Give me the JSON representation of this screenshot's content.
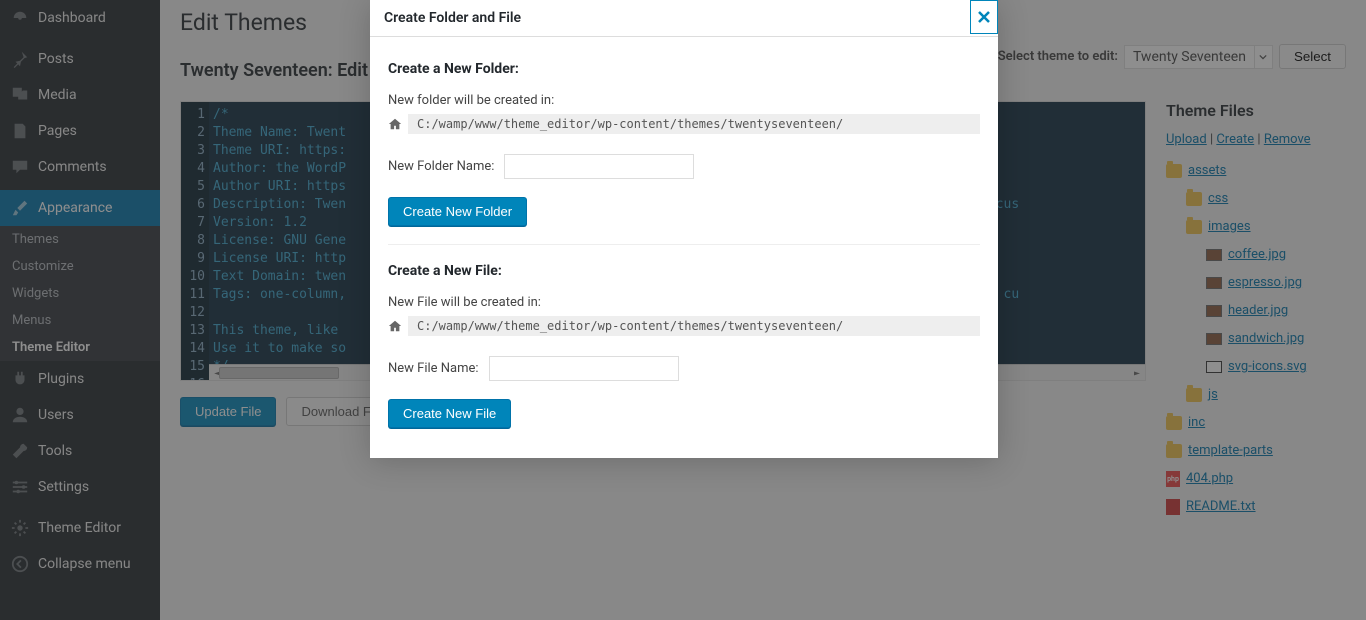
{
  "sidebar": {
    "items": [
      {
        "label": "Dashboard"
      },
      {
        "label": "Posts"
      },
      {
        "label": "Media"
      },
      {
        "label": "Pages"
      },
      {
        "label": "Comments"
      },
      {
        "label": "Appearance",
        "active": true
      },
      {
        "label": "Plugins"
      },
      {
        "label": "Users"
      },
      {
        "label": "Tools"
      },
      {
        "label": "Settings"
      },
      {
        "label": "Theme Editor"
      },
      {
        "label": "Collapse menu"
      }
    ],
    "submenu": [
      {
        "label": "Themes"
      },
      {
        "label": "Customize"
      },
      {
        "label": "Widgets"
      },
      {
        "label": "Menus"
      },
      {
        "label": "Theme Editor",
        "current": true
      }
    ]
  },
  "page": {
    "title": "Edit Themes",
    "subtitle": "Twenty Seventeen: Edit",
    "select_label": "Select theme to edit:",
    "selected_theme": "Twenty Seventeen",
    "select_button": "Select"
  },
  "code": {
    "lines": [
      "/*",
      "Theme Name: Twent",
      "Theme URI: https:",
      "Author: the WordP",
      "Author URI: https",
      "Description: Twen                                                                  images. With a focus",
      "Version: 1.2",
      "License: GNU Gene",
      "License URI: http",
      "Text Domain: twen",
      "Tags: one-column,                                                                  s, custom-header, cu",
      "",
      "This theme, like ",
      "Use it to make so",
      "*/",
      ""
    ]
  },
  "buttons": {
    "update": "Update File",
    "download": "Download File"
  },
  "files": {
    "heading": "Theme Files",
    "actions": {
      "upload": "Upload",
      "create": "Create",
      "remove": "Remove",
      "sep": " | "
    },
    "tree": {
      "assets": "assets",
      "css": "css",
      "images": "images",
      "coffee": "coffee.jpg",
      "espresso": "espresso.jpg",
      "header": "header.jpg",
      "sandwich": "sandwich.jpg",
      "svgicons": "svg-icons.svg",
      "js": "js",
      "inc": "inc",
      "templateparts": "template-parts",
      "f404": "404.php",
      "readme": "README.txt"
    }
  },
  "modal": {
    "title": "Create Folder and File",
    "folder": {
      "heading": "Create a New Folder:",
      "path_label": "New folder will be created in:",
      "path": "C:/wamp/www/theme_editor/wp-content/themes/twentyseventeen/",
      "name_label": "New Folder Name:",
      "button": "Create New Folder"
    },
    "file": {
      "heading": "Create a New File:",
      "path_label": "New File will be created in:",
      "path": "C:/wamp/www/theme_editor/wp-content/themes/twentyseventeen/",
      "name_label": "New File Name:",
      "button": "Create New File"
    }
  }
}
